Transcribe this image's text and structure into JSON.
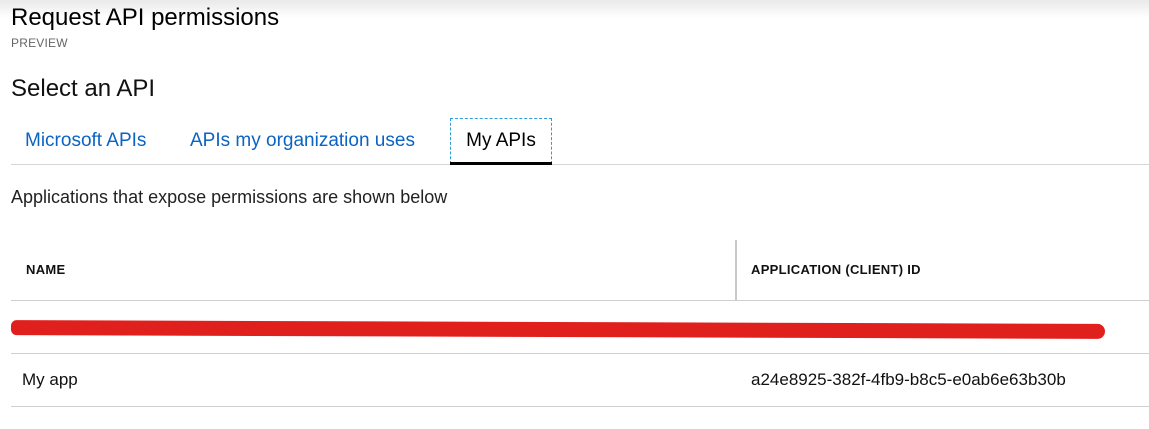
{
  "header": {
    "title": "Request API permissions",
    "subtitle": "PREVIEW"
  },
  "section": {
    "title": "Select an API"
  },
  "tabs": [
    {
      "label": "Microsoft APIs",
      "active": false
    },
    {
      "label": "APIs my organization uses",
      "active": false
    },
    {
      "label": "My APIs",
      "active": true
    }
  ],
  "description": "Applications that expose permissions are shown below",
  "table": {
    "columns": [
      "NAME",
      "APPLICATION (CLIENT) ID"
    ],
    "rows": [
      {
        "name": "",
        "client_id": "",
        "redacted": true
      },
      {
        "name": "My app",
        "client_id": "a24e8925-382f-4fb9-b8c5-e0ab6e63b30b",
        "redacted": false
      }
    ]
  },
  "colors": {
    "link": "#0b63c4",
    "redaction": "#e0201d",
    "focus_outline": "#2f9ed8"
  }
}
